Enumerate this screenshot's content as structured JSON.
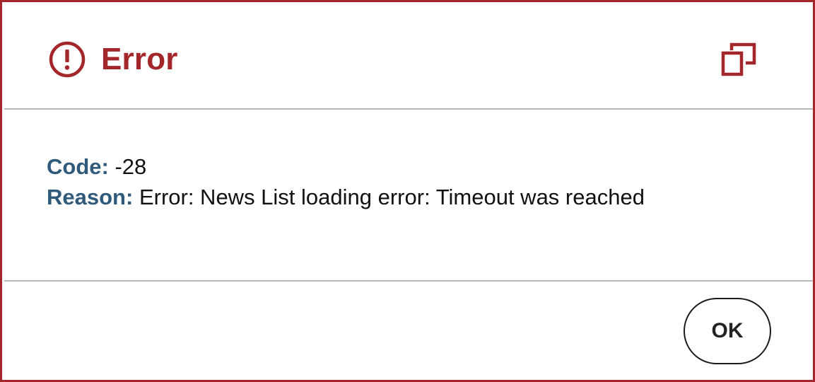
{
  "dialog": {
    "title": "Error",
    "icons": {
      "status": "error-circle-icon",
      "copy": "copy-icon"
    },
    "colors": {
      "accent": "#a3262a",
      "label": "#2f5a7c",
      "text": "#111111",
      "border": "#a3262a",
      "divider": "#b8b8b8"
    },
    "details": {
      "code_label": "Code:",
      "code_value": "-28",
      "reason_label": "Reason:",
      "reason_value": "Error: News List loading error: Timeout was reached"
    },
    "footer": {
      "ok_label": "OK"
    }
  }
}
